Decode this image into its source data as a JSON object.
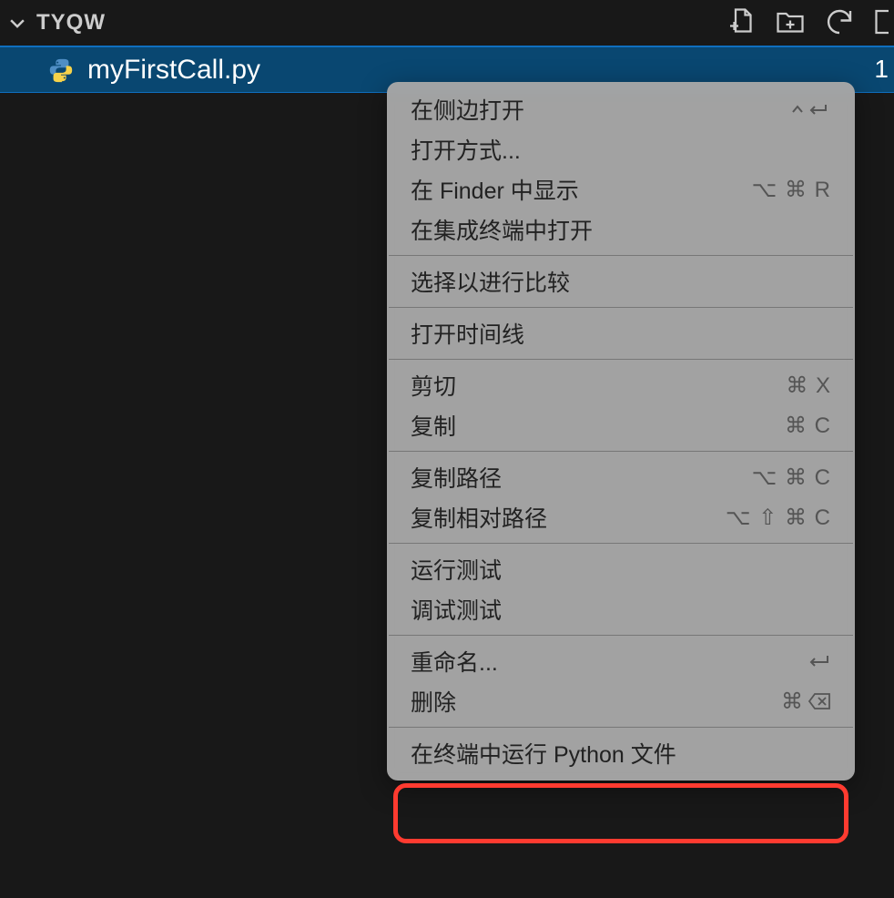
{
  "explorer": {
    "folder_name": "TYQW"
  },
  "file": {
    "name": "myFirstCall.py",
    "badge": "1"
  },
  "context_menu": {
    "groups": [
      [
        {
          "id": "open-side",
          "label": "在侧边打开",
          "shortcut_type": "ctrl-enter"
        },
        {
          "id": "open-with",
          "label": "打开方式...",
          "shortcut": ""
        },
        {
          "id": "reveal-finder",
          "label": "在 Finder 中显示",
          "shortcut": "⌥ ⌘ R"
        },
        {
          "id": "open-integrated-terminal",
          "label": "在集成终端中打开",
          "shortcut": ""
        }
      ],
      [
        {
          "id": "select-compare",
          "label": "选择以进行比较",
          "shortcut": ""
        }
      ],
      [
        {
          "id": "open-timeline",
          "label": "打开时间线",
          "shortcut": ""
        }
      ],
      [
        {
          "id": "cut",
          "label": "剪切",
          "shortcut": "⌘ X"
        },
        {
          "id": "copy",
          "label": "复制",
          "shortcut": "⌘ C"
        }
      ],
      [
        {
          "id": "copy-path",
          "label": "复制路径",
          "shortcut": "⌥ ⌘ C"
        },
        {
          "id": "copy-relative-path",
          "label": "复制相对路径",
          "shortcut": "⌥ ⇧ ⌘ C"
        }
      ],
      [
        {
          "id": "run-test",
          "label": "运行测试",
          "shortcut": ""
        },
        {
          "id": "debug-test",
          "label": "调试测试",
          "shortcut": ""
        }
      ],
      [
        {
          "id": "rename",
          "label": "重命名...",
          "shortcut_type": "enter"
        },
        {
          "id": "delete",
          "label": "删除",
          "shortcut_type": "cmd-del"
        }
      ],
      [
        {
          "id": "run-python-terminal",
          "label": "在终端中运行 Python 文件",
          "shortcut": "",
          "highlighted": true
        }
      ]
    ]
  }
}
